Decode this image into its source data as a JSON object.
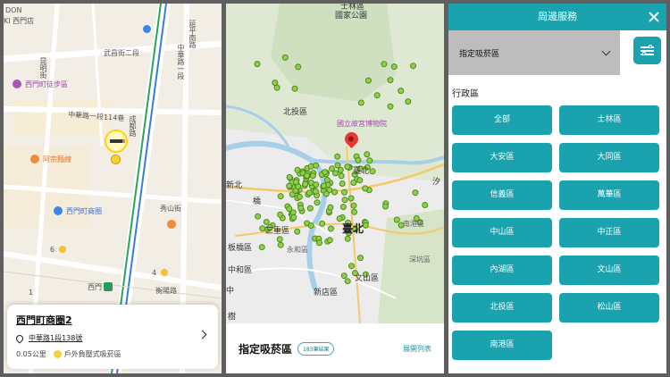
{
  "panel1": {
    "map_labels": {
      "don": "DON",
      "ximending_store": "KI 西門店",
      "wuchang_st3": "武昌街二段",
      "ximending_walk": "西門町徒步區",
      "zhonghua_114": "中華路一段114巷",
      "kunming_v": "昆明街",
      "zhonghua_v": "中華路一段",
      "yanping_v": "延平南路",
      "chengdu_v": "成都路",
      "xiushan": "秀山街",
      "atsung": "阿宗麵線",
      "ximen_shopping": "西門町商圈",
      "ximen_station": "西門",
      "hengyang": "衡陽路",
      "num6": "6",
      "num4": "4",
      "num1": "1"
    },
    "card": {
      "title": "西門町商圈2",
      "address": "中華路1段138號",
      "distance": "0.05公里",
      "type": "戶外負壓式吸菸區"
    }
  },
  "panel2": {
    "map_labels": {
      "shilin": "士林區",
      "national_park": "國家公園",
      "beitou": "北投區",
      "museum": "國立故宮博物院",
      "taipei_station": "臺北",
      "city": "臺北",
      "nangang": "南港區",
      "xi": "汐",
      "sanchong": "三重區",
      "banqiao": "板橋區",
      "zhonghe": "中和區",
      "yonghe": "永和區",
      "wenshan": "文山區",
      "xindian": "新店區",
      "shenkeng": "深坑區",
      "ji": "樹",
      "xinbei": "新北",
      "qiao": "橋",
      "zhongzhi": "中"
    },
    "title": "指定吸菸區",
    "badge": "183筆結果",
    "link": "展開列表"
  },
  "panel3": {
    "header_title": "周邊服務",
    "select_value": "指定吸菸區",
    "section_title": "行政區",
    "districts": [
      "全部",
      "士林區",
      "大安區",
      "大同區",
      "信義區",
      "萬華區",
      "中山區",
      "中正區",
      "內湖區",
      "文山區",
      "北投區",
      "松山區",
      "南港區"
    ],
    "accent_color": "#1aa3af"
  }
}
